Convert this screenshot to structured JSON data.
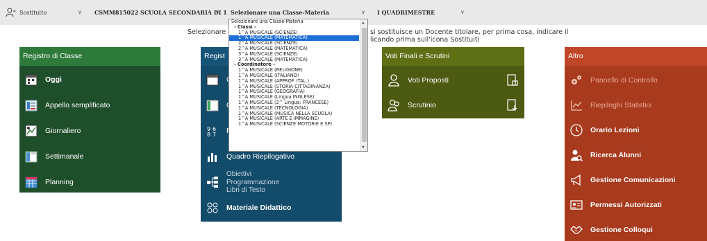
{
  "topbar": {
    "user_label": "Sostituito",
    "school": "CSMM815022 SCUOLA SECONDARIA DI 1",
    "class_select": "Selezionare una Classe-Materia",
    "period": "I QUADRIMESTRE",
    "chevron": "∨"
  },
  "notice": {
    "left": "Selezionare",
    "right_line1": "si sostituisce un Docente titolare, per prima cosa, indicare il",
    "right_line2": "licando prima sull'icona Sostituiti"
  },
  "dropdown": {
    "options": [
      {
        "label": "Selezionare una Classe-Materia",
        "kind": "plain"
      },
      {
        "label": "- Classi -",
        "kind": "group"
      },
      {
        "label": "1^A MUSICALE (SCIENZE)",
        "kind": "item"
      },
      {
        "label": "1^A MUSICALE (MATEMATICA)",
        "kind": "selected"
      },
      {
        "label": "2^A MUSICALE (SCIENZE)",
        "kind": "item"
      },
      {
        "label": "2^A MUSICALE (MATEMATICA)",
        "kind": "item"
      },
      {
        "label": "3^A MUSICALE (SCIENZE)",
        "kind": "item"
      },
      {
        "label": "3^A MUSICALE (MATEMATICA)",
        "kind": "item"
      },
      {
        "label": "- Coordinatore -",
        "kind": "group"
      },
      {
        "label": "1^A MUSICALE (RELIGIONE)",
        "kind": "item"
      },
      {
        "label": "1^A MUSICALE (ITALIANO)",
        "kind": "item"
      },
      {
        "label": "1^A MUSICALE (APPROF. ITAL.)",
        "kind": "item"
      },
      {
        "label": "1^A MUSICALE (STORIA CITTADINANZA)",
        "kind": "item"
      },
      {
        "label": "1^A MUSICALE (GEOGRAFIA)",
        "kind": "item"
      },
      {
        "label": "1^A MUSICALE (Lingua INGLESE)",
        "kind": "item"
      },
      {
        "label": "1^A MUSICALE (2^ Lingua: FRANCESE)",
        "kind": "item"
      },
      {
        "label": "1^A MUSICALE (TECNOLOGIA)",
        "kind": "item"
      },
      {
        "label": "1^A MUSICALE (MUSICA NELLA SCUOLA)",
        "kind": "item"
      },
      {
        "label": "1^A MUSICALE (ARTE E IMMAGINE)",
        "kind": "item"
      },
      {
        "label": "1^A MUSICALE (SCIENZE MOTORIE E SP)",
        "kind": "item"
      }
    ]
  },
  "registro_classe": {
    "title": "Registro di Classe",
    "items": [
      "Oggi",
      "Appello semplificato",
      "Giornaliero",
      "Settimanale",
      "Planning"
    ]
  },
  "registro_docente": {
    "title": "Regist",
    "partial_items": [
      "C",
      "C",
      "P"
    ],
    "quadro": "Quadro Riepilogativo",
    "obiettivi": [
      "Obiettivi",
      "Programmazione",
      "Libri di Testo"
    ],
    "materiale": "Materiale Didattico"
  },
  "voti": {
    "title": "Voti Finali e Scrutini",
    "items": [
      "Voti Proposti",
      "Scrutinio"
    ]
  },
  "altro": {
    "title": "Altro",
    "items": [
      "Pannello di Controllo",
      "Riepiloghi Statistici",
      "Orario Lezioni",
      "Ricerca Alunni",
      "Gestione Comunicazioni",
      "Permessi Autorizzati",
      "Gestione Colloqui"
    ]
  },
  "colors": {
    "green": "#1f4e2b",
    "blue": "#134b6a",
    "olive": "#4d5a12",
    "red": "#a83a1e",
    "selection": "#1e6fd6"
  }
}
